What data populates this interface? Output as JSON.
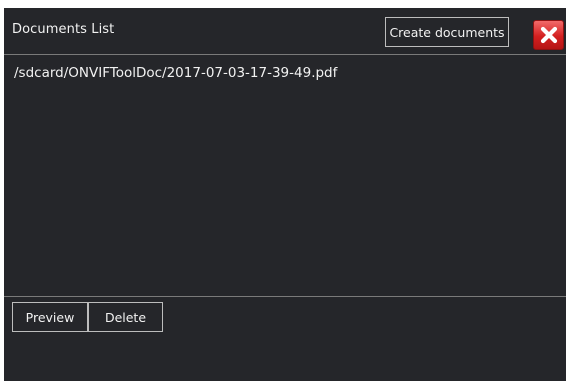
{
  "dialog": {
    "title": "Documents List",
    "create_label": "Create documents",
    "close_icon": "close-icon"
  },
  "documents": [
    {
      "path": "/sdcard/ONVIFToolDoc/2017-07-03-17-39-49.pdf"
    }
  ],
  "footer": {
    "preview_label": "Preview",
    "delete_label": "Delete"
  },
  "colors": {
    "background": "#25262a",
    "text": "#f2f2f2",
    "divider": "#7a7a7a",
    "close_red": "#d32020"
  }
}
